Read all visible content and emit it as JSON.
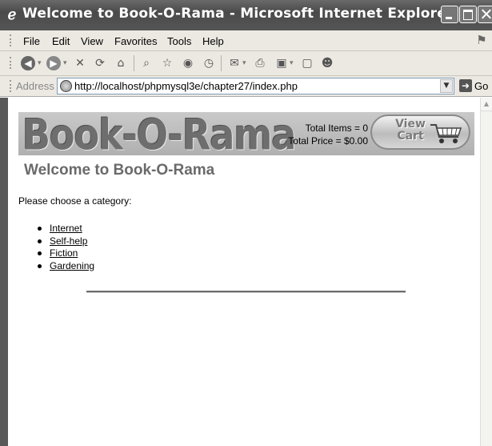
{
  "window": {
    "title": "Welcome to Book-O-Rama - Microsoft Internet Explorer"
  },
  "menu": {
    "items": [
      "File",
      "Edit",
      "View",
      "Favorites",
      "Tools",
      "Help"
    ]
  },
  "toolbar": {
    "icons": [
      "back-icon",
      "forward-icon",
      "stop-icon",
      "refresh-icon",
      "home-icon",
      "search-icon",
      "favorites-icon",
      "media-icon",
      "history-icon",
      "mail-icon",
      "print-icon",
      "edit-icon",
      "discuss-icon",
      "messenger-icon"
    ]
  },
  "address": {
    "label": "Address",
    "url": "http://localhost/phpmysql3e/chapter27/index.php",
    "go_label": "Go"
  },
  "page": {
    "logo": "Book-O-Rama",
    "total_items": "Total Items = 0",
    "total_price": "Total Price = $0.00",
    "view_cart_line1": "View",
    "view_cart_line2": "Cart",
    "heading": "Welcome to Book-O-Rama",
    "prompt": "Please choose a category:",
    "categories": [
      "Internet",
      "Self-help",
      "Fiction",
      "Gardening"
    ]
  },
  "colors": {
    "titlebar": "#555555",
    "chrome": "#ece9e2",
    "banner": "#bdbdbd",
    "heading": "#6a6a6a"
  }
}
